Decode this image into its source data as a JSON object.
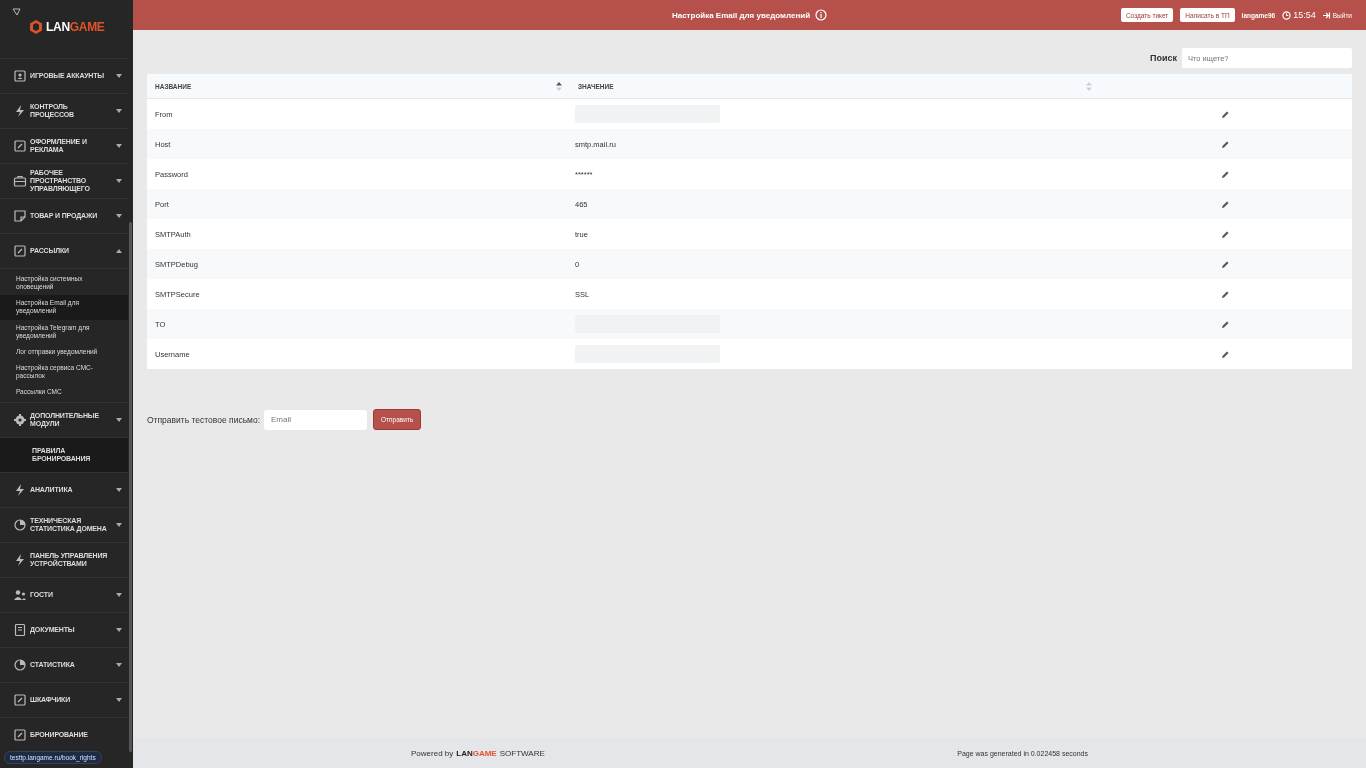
{
  "logo": {
    "part_1": "LAN",
    "part_2": "GAME"
  },
  "sidebar": {
    "items": [
      {
        "kind": "account",
        "label": "ИГРОВЫЕ АККАУНТЫ",
        "expanded": false,
        "selected": false
      },
      {
        "kind": "bolt",
        "label": "КОНТРОЛЬ ПРОЦЕССОВ",
        "expanded": false,
        "selected": false
      },
      {
        "kind": "edit",
        "label": "ОФОРМЛЕНИЕ И РЕКЛАМА",
        "expanded": false,
        "selected": false
      },
      {
        "kind": "case",
        "label": "РАБОЧЕЕ ПРОСТРАНСТВО УПРАВЛЯЮЩЕГО",
        "expanded": false,
        "selected": false
      },
      {
        "kind": "note",
        "label": "ТОВАР И ПРОДАЖИ",
        "expanded": false,
        "selected": false
      },
      {
        "kind": "edit",
        "label": "РАССЫЛКИ",
        "expanded": true,
        "selected": false,
        "children": [
          {
            "label": "Настройка системных оповещений",
            "selected": false
          },
          {
            "label": "Настройка Email для уведомлений",
            "selected": true
          },
          {
            "label": "Настройка Telegram для уведомлений",
            "selected": false
          },
          {
            "label": "Лог отправки уведомлений",
            "selected": false
          },
          {
            "label": "Настройка сервиса СМС-рассылок",
            "selected": false
          },
          {
            "label": "Рассылки СМС",
            "selected": false
          }
        ]
      },
      {
        "kind": "gear",
        "label": "ДОПОЛНИТЕЛЬНЫЕ МОДУЛИ",
        "expanded": false,
        "selected": false
      },
      {
        "kind": "none",
        "label": "ПРАВИЛА БРОНИРОВАНИЯ",
        "selected": true
      },
      {
        "kind": "bolt",
        "label": "АНАЛИТИКА",
        "expanded": false,
        "selected": false
      },
      {
        "kind": "pie",
        "label": "ТЕХНИЧЕСКАЯ СТАТИСТИКА ДОМЕНА",
        "expanded": false,
        "selected": false
      },
      {
        "kind": "bolt",
        "label": "ПАНЕЛЬ УПРАВЛЕНИЯ УСТРОЙСТВАМИ",
        "selected": false
      },
      {
        "kind": "guests",
        "label": "ГОСТИ",
        "expanded": false,
        "selected": false
      },
      {
        "kind": "doc",
        "label": "ДОКУМЕНТЫ",
        "expanded": false,
        "selected": false
      },
      {
        "kind": "pie",
        "label": "СТАТИСТИКА",
        "expanded": false,
        "selected": false
      },
      {
        "kind": "edit",
        "label": "ШКАФЧИКИ",
        "expanded": false,
        "selected": false
      },
      {
        "kind": "edit",
        "label": "БРОНИРОВАНИЕ",
        "selected": false
      }
    ]
  },
  "status_link": "testtp.langame.ru/book_rights",
  "header": {
    "title": "Настройка Email для уведомлений",
    "buttons": [
      "Создать тикет",
      "Написать в ТП"
    ],
    "user": "langame96",
    "time": "15:54",
    "logout": "Выйти"
  },
  "search": {
    "label": "Поиск",
    "placeholder": "Что ищете?"
  },
  "table": {
    "columns": [
      {
        "label": "НАЗВАНИЕ",
        "sorted": true
      },
      {
        "label": "ЗНАЧЕНИЕ",
        "sorted": false
      }
    ],
    "rows": [
      {
        "name": "From",
        "redacted": true
      },
      {
        "name": "Host",
        "value": "smtp.mail.ru"
      },
      {
        "name": "Password",
        "value": "******"
      },
      {
        "name": "Port",
        "value": "465"
      },
      {
        "name": "SMTPAuth",
        "value": "true"
      },
      {
        "name": "SMTPDebug",
        "value": "0"
      },
      {
        "name": "SMTPSecure",
        "value": "SSL"
      },
      {
        "name": "TO",
        "redacted": true
      },
      {
        "name": "Username",
        "redacted": true
      }
    ]
  },
  "test_mail": {
    "label": "Отправить тестовое письмо:",
    "placeholder": "Email",
    "button": "Отправить"
  },
  "footer": {
    "powered": "Powered by",
    "brand_1": "LAN",
    "brand_2": "GAME",
    "brand_3": "SOFTWARE",
    "generated": "Page was generated in 0.022458 seconds"
  }
}
